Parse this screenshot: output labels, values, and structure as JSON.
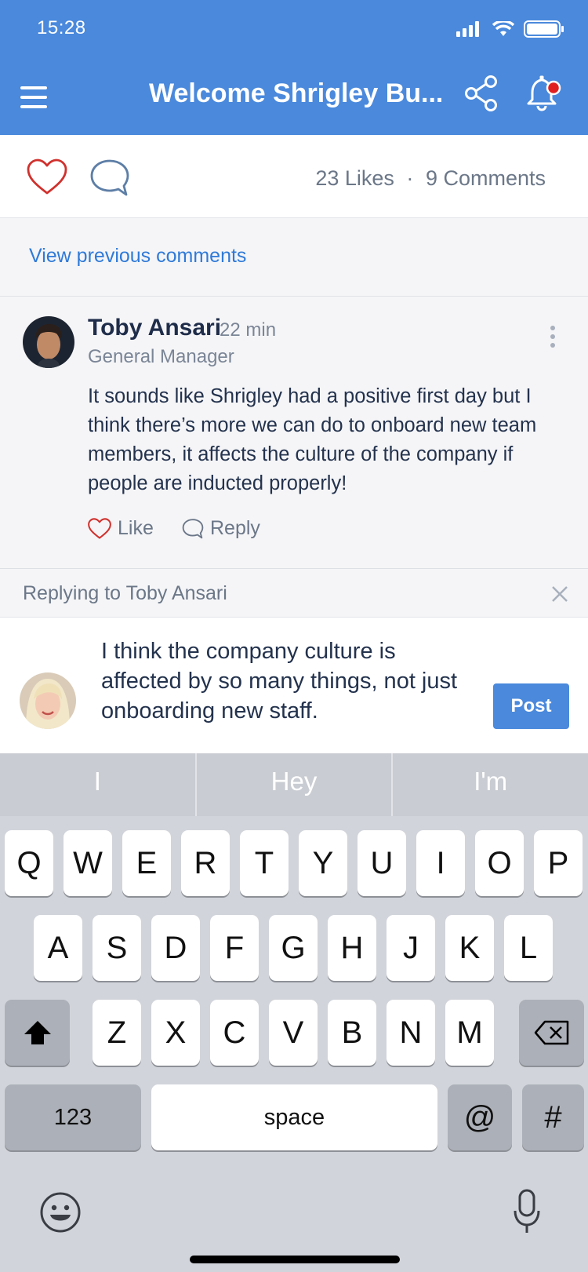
{
  "status_bar": {
    "time": "15:28"
  },
  "header": {
    "title": "Welcome Shrigley Bu..."
  },
  "reactions": {
    "likes": "23 Likes",
    "separator": "·",
    "comments": "9 Comments"
  },
  "view_previous": "View previous comments",
  "comment": {
    "author": "Toby Ansari",
    "time": "22 min",
    "role": "General Manager",
    "text": "It sounds like Shrigley had a positive first day but I think there’s more we can do to onboard new team members, it affects the culture of the company if people are inducted properly!",
    "like_label": "Like",
    "reply_label": "Reply"
  },
  "replying": {
    "label": "Replying to Toby Ansari"
  },
  "composer": {
    "text": "I think the company culture is affected by so many things, not just onboarding new staff.",
    "post_label": "Post"
  },
  "keyboard": {
    "suggestions": [
      "I",
      "Hey",
      "I'm"
    ],
    "row1": [
      "Q",
      "W",
      "E",
      "R",
      "T",
      "Y",
      "U",
      "I",
      "O",
      "P"
    ],
    "row2": [
      "A",
      "S",
      "D",
      "F",
      "G",
      "H",
      "J",
      "K",
      "L"
    ],
    "row3": [
      "Z",
      "X",
      "C",
      "V",
      "B",
      "N",
      "M"
    ],
    "numbers_label": "123",
    "space_label": "space",
    "at_label": "@",
    "hash_label": "#"
  },
  "colors": {
    "header": "#4a89dc",
    "accent_link": "#2f7ad8",
    "heart": "#d0312d",
    "notification_dot": "#e02020"
  }
}
